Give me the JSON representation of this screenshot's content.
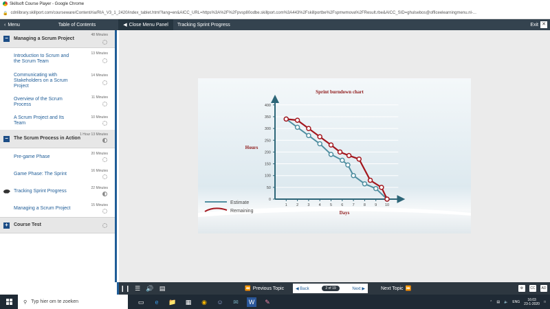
{
  "browser": {
    "window_title": "Skillsoft Course Player - Google Chrome",
    "url": "cdnlibrary.skillport.com/courseware/Content/ria/RIA_V3_1_2420/index_tablet.html?lang=en&AICC_URL=https%3A%2F%2Fpvsp80odbe.skillport.com%3A443%2Fskillportbe%2Fspmwmova%2FResult.rbe&AICC_SID=ghulsebos@officeelearningmenu.nl-..."
  },
  "header": {
    "menu_label": "Menu",
    "toc_label": "Table of Contents",
    "close_panel_label": "Close Menu Panel",
    "page_title": "Tracking Sprint Progress",
    "exit_label": "Exit"
  },
  "sidebar": {
    "sections": [
      {
        "title": "Managing a Scrum Project",
        "duration": "48 Minutes",
        "items": [
          {
            "label": "Introduction to Scrum and the Scrum Team",
            "duration": "13 Minutes"
          },
          {
            "label": "Communicating with Stakeholders on a Scrum Project",
            "duration": "14 Minutes"
          },
          {
            "label": "Overview of the Scrum Process",
            "duration": "11 Minutes"
          },
          {
            "label": "A Scrum Project and Its Team",
            "duration": "10 Minutes"
          }
        ]
      },
      {
        "title": "The Scrum Process in Action",
        "duration": "1 Hour 13 Minutes",
        "items": [
          {
            "label": "Pre-game Phase",
            "duration": "20 Minutes"
          },
          {
            "label": "Game Phase: The Sprint",
            "duration": "16 Minutes"
          },
          {
            "label": "Tracking Sprint Progress",
            "duration": "22 Minutes"
          },
          {
            "label": "Managing a Scrum Project",
            "duration": "15 Minutes"
          }
        ]
      },
      {
        "title": "Course Test",
        "duration": ""
      }
    ]
  },
  "chart_data": {
    "type": "line",
    "title": "Sprint burndown chart",
    "xlabel": "Days",
    "ylabel": "Hours",
    "xlim": [
      0,
      11
    ],
    "ylim": [
      0,
      420
    ],
    "x_ticks": [
      1,
      2,
      3,
      4,
      5,
      6,
      7,
      8,
      9,
      10
    ],
    "y_ticks": [
      0,
      50,
      100,
      150,
      200,
      250,
      300,
      350,
      400
    ],
    "legend_position": "bottom-left",
    "series": [
      {
        "name": "Estimate",
        "color": "#4f8ea0",
        "x": [
          1,
          2,
          3,
          4,
          5,
          6,
          6.5,
          7,
          8,
          9,
          10
        ],
        "y": [
          340,
          305,
          270,
          235,
          190,
          165,
          145,
          100,
          65,
          45,
          0
        ]
      },
      {
        "name": "Remaining",
        "color": "#a3161d",
        "x": [
          1,
          2,
          3,
          4,
          5,
          5.8,
          6.6,
          7.5,
          8.5,
          9.5,
          10
        ],
        "y": [
          340,
          335,
          300,
          265,
          230,
          200,
          185,
          170,
          80,
          50,
          0
        ]
      }
    ]
  },
  "controls": {
    "prev_label": "Previous Topic",
    "back_label": "Back",
    "page_indicator": "2 of 19",
    "next_label": "Next",
    "next_topic_label": "Next Topic"
  },
  "taskbar": {
    "search_placeholder": "Typ hier om te zoeken",
    "language": "ENG",
    "time": "16:03",
    "date": "23-1-2020"
  }
}
